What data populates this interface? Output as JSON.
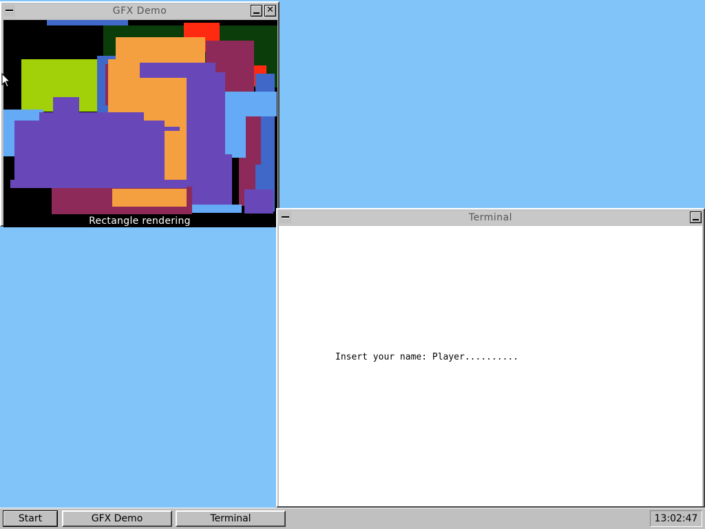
{
  "colors": {
    "desktop": "#80c4fa",
    "window_frame": "#c0c0c0",
    "canvas_bg": "#000000",
    "terminal_bg": "#ffffff"
  },
  "gfx_window": {
    "title": "GFX Demo",
    "caption": "Rectangle rendering"
  },
  "terminal_window": {
    "title": "Terminal",
    "prompt_line": "Insert your name: Player.........."
  },
  "taskbar": {
    "start_label": "Start",
    "tasks": [
      "GFX Demo",
      "Terminal"
    ],
    "clock": "13:02:47"
  },
  "icons": {
    "system_menu": "system-menu-icon",
    "minimize": "minimize-icon",
    "close": "close-icon",
    "cursor": "mouse-pointer-icon"
  }
}
